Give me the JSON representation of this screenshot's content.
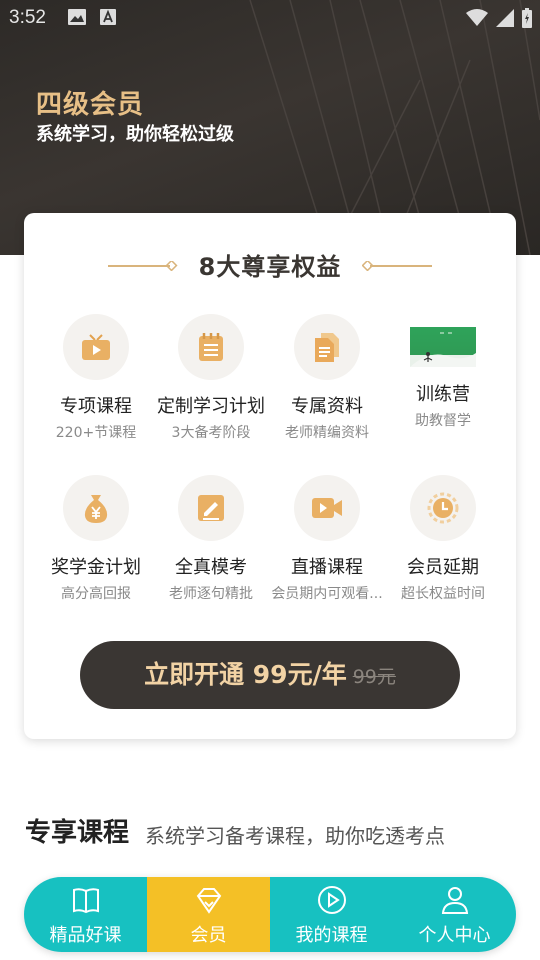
{
  "status_bar": {
    "time": "3:52"
  },
  "hero": {
    "title": "四级会员",
    "subtitle": "系统学习，助你轻松过级"
  },
  "benefits_card": {
    "heading": "8大尊享权益",
    "items": [
      {
        "title": "专项课程",
        "sub": "220+节课程",
        "icon": "tv-icon"
      },
      {
        "title": "定制学习计划",
        "sub": "3大备考阶段",
        "icon": "calendar-icon"
      },
      {
        "title": "专属资料",
        "sub": "老师精编资料",
        "icon": "document-icon"
      },
      {
        "title": "训练营",
        "sub": "助教督学",
        "icon": "training-camp-image"
      },
      {
        "title": "奖学金计划",
        "sub": "高分高回报",
        "icon": "money-bag-icon"
      },
      {
        "title": "全真模考",
        "sub": "老师逐句精批",
        "icon": "exam-edit-icon"
      },
      {
        "title": "直播课程",
        "sub": "会员期内可观看...",
        "icon": "video-camera-icon"
      },
      {
        "title": "会员延期",
        "sub": "超长权益时间",
        "icon": "clock-icon"
      }
    ],
    "cta_label": "立即开通 99元/年",
    "cta_original_price": "99元"
  },
  "section": {
    "title": "专享课程",
    "subtitle": "系统学习备考课程，助你吃透考点"
  },
  "bottom_nav": {
    "items": [
      {
        "label": "精品好课",
        "icon": "book-icon"
      },
      {
        "label": "会员",
        "icon": "diamond-icon"
      },
      {
        "label": "我的课程",
        "icon": "play-circle-icon"
      },
      {
        "label": "个人中心",
        "icon": "user-icon"
      }
    ],
    "active_index": 1
  },
  "colors": {
    "gold": "#e7bf86",
    "teal": "#17c1c1",
    "yellow": "#f4c026",
    "dark": "#3a3633"
  }
}
